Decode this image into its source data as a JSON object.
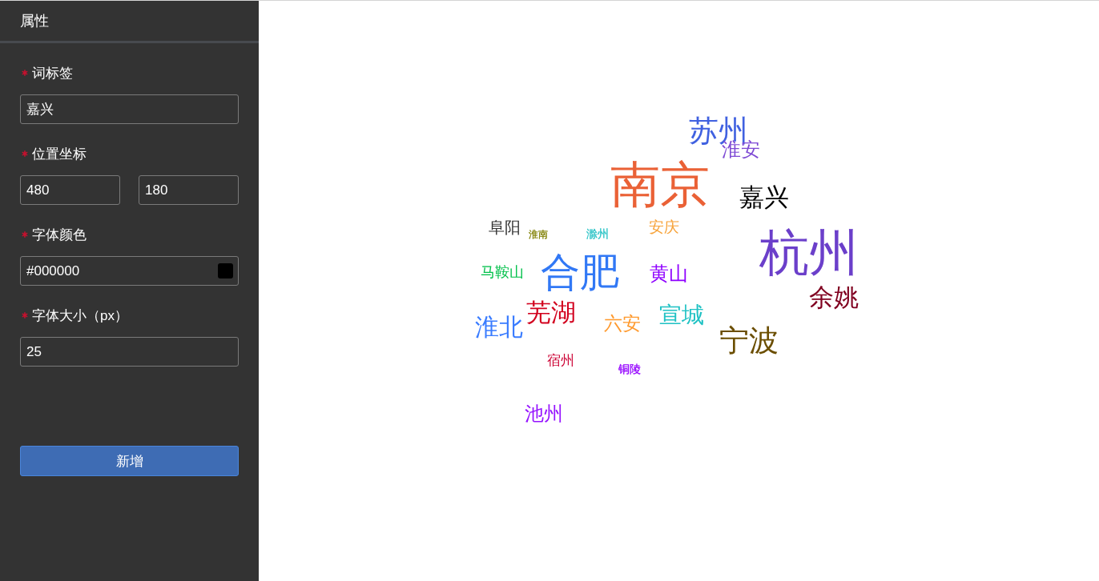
{
  "panel": {
    "title": "属性",
    "fields": [
      {
        "kind": "text",
        "label": "词标签",
        "required": true,
        "value": "嘉兴"
      },
      {
        "kind": "pair",
        "label": "位置坐标",
        "required": true,
        "values": [
          "480",
          "180"
        ]
      },
      {
        "kind": "color",
        "label": "字体颜色",
        "required": true,
        "value": "#000000",
        "color": "#000000"
      },
      {
        "kind": "text",
        "label": "字体大小（px）",
        "required": true,
        "value": "25"
      }
    ],
    "submit_button": "新增"
  },
  "word_cloud": {
    "words": [
      {
        "text": "苏州",
        "color": "#4061e0"
      },
      {
        "text": "淮安",
        "color": "#7e4ad4"
      },
      {
        "text": "南京",
        "color": "#ea6136"
      },
      {
        "text": "嘉兴",
        "color": "#000000"
      },
      {
        "text": "阜阳",
        "color": "#333333"
      },
      {
        "text": "淮南",
        "color": "#7f7f00"
      },
      {
        "text": "滁州",
        "color": "#2ac3c6"
      },
      {
        "text": "安庆",
        "color": "#f7a33a"
      },
      {
        "text": "马鞍山",
        "color": "#00c04a"
      },
      {
        "text": "合肥",
        "color": "#3178f5"
      },
      {
        "text": "黄山",
        "color": "#8f00ff"
      },
      {
        "text": "杭州",
        "color": "#6b3fca"
      },
      {
        "text": "余姚",
        "color": "#800020"
      },
      {
        "text": "淮北",
        "color": "#3a7cff"
      },
      {
        "text": "芜湖",
        "color": "#d2001e"
      },
      {
        "text": "六安",
        "color": "#ff9a2e"
      },
      {
        "text": "宣城",
        "color": "#20c2c4"
      },
      {
        "text": "宁波",
        "color": "#6b4e00"
      },
      {
        "text": "宿州",
        "color": "#cc0033"
      },
      {
        "text": "铜陵",
        "color": "#9400ff"
      },
      {
        "text": "池州",
        "color": "#9512ff"
      }
    ]
  }
}
